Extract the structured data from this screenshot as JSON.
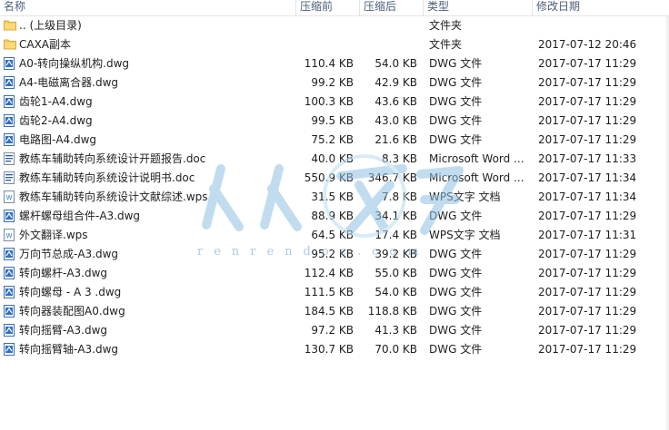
{
  "columns": {
    "name": "名称",
    "compressed": "压缩前",
    "size": "压缩后",
    "type": "类型",
    "date": "修改日期"
  },
  "watermark": {
    "text": "人人文库",
    "url": "renrendoc.com"
  },
  "files": [
    {
      "icon": "folder-icon",
      "name": ".. (上级目录)",
      "compressed": "",
      "size": "",
      "type": "文件夹",
      "date": ""
    },
    {
      "icon": "folder-icon",
      "name": "CAXA副本",
      "compressed": "",
      "size": "",
      "type": "文件夹",
      "date": "2017-07-12 20:46"
    },
    {
      "icon": "dwg-file-icon",
      "name": "A0-转向操纵机构.dwg",
      "compressed": "110.4 KB",
      "size": "54.0 KB",
      "type": "DWG 文件",
      "date": "2017-07-17 11:29"
    },
    {
      "icon": "dwg-file-icon",
      "name": "A4-电磁离合器.dwg",
      "compressed": "99.2 KB",
      "size": "42.9 KB",
      "type": "DWG 文件",
      "date": "2017-07-17 11:29"
    },
    {
      "icon": "dwg-file-icon",
      "name": "齿轮1-A4.dwg",
      "compressed": "100.3 KB",
      "size": "43.6 KB",
      "type": "DWG 文件",
      "date": "2017-07-17 11:29"
    },
    {
      "icon": "dwg-file-icon",
      "name": "齿轮2-A4.dwg",
      "compressed": "99.5 KB",
      "size": "43.0 KB",
      "type": "DWG 文件",
      "date": "2017-07-17 11:29"
    },
    {
      "icon": "dwg-file-icon",
      "name": "电路图-A4.dwg",
      "compressed": "75.2 KB",
      "size": "21.6 KB",
      "type": "DWG 文件",
      "date": "2017-07-17 11:29"
    },
    {
      "icon": "doc-file-icon",
      "name": "教练车辅助转向系统设计开题报告.doc",
      "compressed": "40.0 KB",
      "size": "8.3 KB",
      "type": "Microsoft Word ...",
      "date": "2017-07-17 11:33"
    },
    {
      "icon": "doc-file-icon",
      "name": "教练车辅助转向系统设计说明书.doc",
      "compressed": "550.9 KB",
      "size": "346.7 KB",
      "type": "Microsoft Word ...",
      "date": "2017-07-17 11:34"
    },
    {
      "icon": "wps-file-icon",
      "name": "教练车辅助转向系统设计文献综述.wps",
      "compressed": "31.5 KB",
      "size": "7.8 KB",
      "type": "WPS文字 文档",
      "date": "2017-07-17 11:34"
    },
    {
      "icon": "dwg-file-icon",
      "name": "螺杆螺母组合件-A3.dwg",
      "compressed": "88.9 KB",
      "size": "34.1 KB",
      "type": "DWG 文件",
      "date": "2017-07-17 11:29"
    },
    {
      "icon": "wps-file-icon",
      "name": "外文翻译.wps",
      "compressed": "64.5 KB",
      "size": "17.4 KB",
      "type": "WPS文字 文档",
      "date": "2017-07-17 11:31"
    },
    {
      "icon": "dwg-file-icon",
      "name": "万向节总成-A3.dwg",
      "compressed": "95.2 KB",
      "size": "39.2 KB",
      "type": "DWG 文件",
      "date": "2017-07-17 11:29"
    },
    {
      "icon": "dwg-file-icon",
      "name": "转向螺杆-A3.dwg",
      "compressed": "112.4 KB",
      "size": "55.0 KB",
      "type": "DWG 文件",
      "date": "2017-07-17 11:29"
    },
    {
      "icon": "dwg-file-icon",
      "name": "转向螺母 - A 3 .dwg",
      "compressed": "111.5 KB",
      "size": "54.0 KB",
      "type": "DWG 文件",
      "date": "2017-07-17 11:29"
    },
    {
      "icon": "dwg-file-icon",
      "name": "转向器装配图A0.dwg",
      "compressed": "184.5 KB",
      "size": "118.8 KB",
      "type": "DWG 文件",
      "date": "2017-07-17 11:29"
    },
    {
      "icon": "dwg-file-icon",
      "name": "转向摇臂-A3.dwg",
      "compressed": "97.2 KB",
      "size": "41.3 KB",
      "type": "DWG 文件",
      "date": "2017-07-17 11:29"
    },
    {
      "icon": "dwg-file-icon",
      "name": "转向摇臂轴-A3.dwg",
      "compressed": "130.7 KB",
      "size": "70.0 KB",
      "type": "DWG 文件",
      "date": "2017-07-17 11:29"
    }
  ]
}
